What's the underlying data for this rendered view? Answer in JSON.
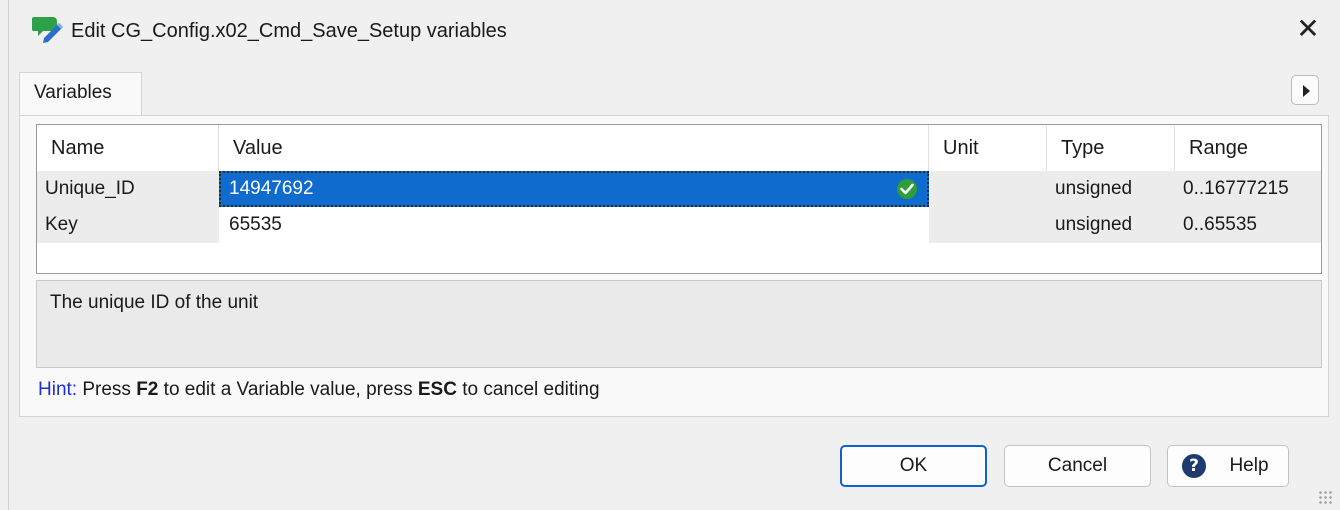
{
  "window": {
    "title": "Edit CG_Config.x02_Cmd_Save_Setup variables",
    "close_glyph": "✕",
    "icon": "edit-variables-icon"
  },
  "tabs": [
    {
      "label": "Variables",
      "active": true
    }
  ],
  "grid": {
    "columns": [
      "Name",
      "Value",
      "Unit",
      "Type",
      "Range"
    ],
    "rows": [
      {
        "name": "Unique_ID",
        "value": "14947692",
        "unit": "",
        "type": "unsigned",
        "range": "0..16777215",
        "selected": true
      },
      {
        "name": "Key",
        "value": "65535",
        "unit": "",
        "type": "unsigned",
        "range": "0..65535",
        "selected": false
      }
    ]
  },
  "description": "The unique ID of the unit",
  "hint": {
    "label": "Hint:",
    "part1": " Press ",
    "key1": "F2",
    "part2": " to edit a Variable value, press ",
    "key2": "ESC",
    "part3": " to cancel editing"
  },
  "buttons": {
    "ok": "OK",
    "cancel": "Cancel",
    "help": "Help",
    "help_glyph": "?"
  },
  "colors": {
    "selection": "#0f6cce",
    "hint_label": "#1f2fd6",
    "valid_check": "#2e9d3c",
    "default_button_border": "#0f63c4"
  }
}
